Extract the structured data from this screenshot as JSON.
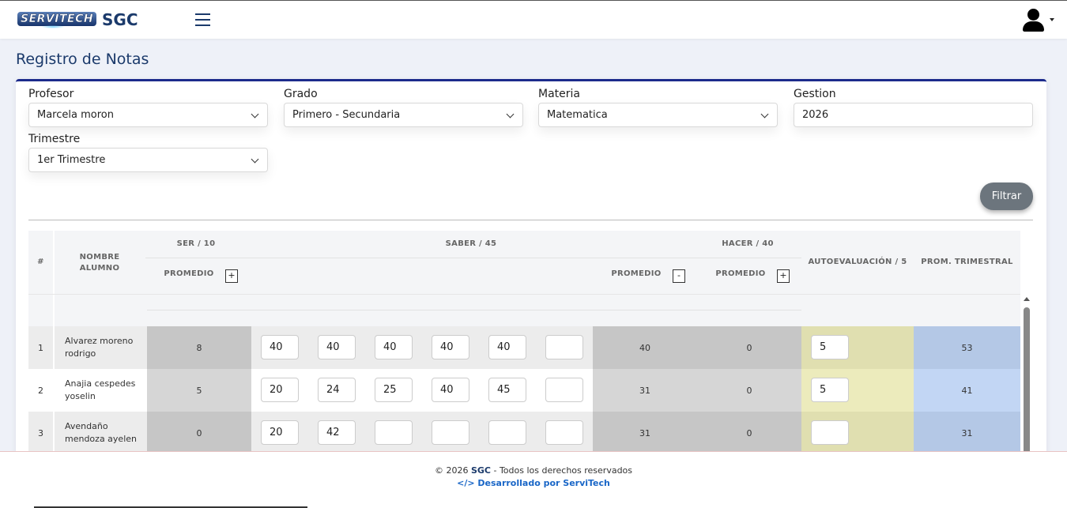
{
  "header": {
    "logo_text": "SERVITECH",
    "app_title": "SGC"
  },
  "page_title": "Registro de Notas",
  "filters": {
    "profesor": {
      "label": "Profesor",
      "value": "Marcela moron"
    },
    "grado": {
      "label": "Grado",
      "value": "Primero - Secundaria"
    },
    "materia": {
      "label": "Materia",
      "value": "Matematica"
    },
    "gestion": {
      "label": "Gestion",
      "value": "2026"
    },
    "trimestre": {
      "label": "Trimestre",
      "value": "1er Trimestre"
    },
    "filter_button": "Filtrar"
  },
  "table": {
    "headers": {
      "num": "#",
      "nombre": "NOMBRE ALUMNO",
      "ser": "SER / 10",
      "saber": "SABER / 45",
      "hacer": "HACER / 40",
      "autoevaluacion": "AUTOEVALUACIÓN / 5",
      "prom_trimestral": "PROM. TRIMESTRAL",
      "promedio": "PROMEDIO",
      "toggle_plus": "+",
      "toggle_minus": "-"
    },
    "rows": [
      {
        "num": "1",
        "name": "Alvarez moreno rodrigo",
        "ser": "8",
        "saber": [
          "40",
          "40",
          "40",
          "40",
          "40",
          ""
        ],
        "saber_prom": "40",
        "hacer_prom": "0",
        "auto": "5",
        "prom": "53"
      },
      {
        "num": "2",
        "name": "Anajia cespedes yoselin",
        "ser": "5",
        "saber": [
          "20",
          "24",
          "25",
          "40",
          "45",
          ""
        ],
        "saber_prom": "31",
        "hacer_prom": "0",
        "auto": "5",
        "prom": "41"
      },
      {
        "num": "3",
        "name": "Avendaño mendoza ayelen",
        "ser": "0",
        "saber": [
          "20",
          "42",
          "",
          "",
          "",
          ""
        ],
        "saber_prom": "31",
        "hacer_prom": "0",
        "auto": "",
        "prom": "31"
      }
    ]
  },
  "footer": {
    "copyright_prefix": "© 2026",
    "copyright_brand": "SGC",
    "copyright_suffix": "- Todos los derechos reservados",
    "dev_text": "</> Desarrollado por ServiTech"
  },
  "colors": {
    "brand": "#1b3a6b",
    "card_top_border": "#1c2b8c",
    "filter_button": "#6c757d",
    "ser_column": "#c8c8c8",
    "auto_column": "#e6e6b4",
    "prom_column": "#b4c8e6",
    "footer_link": "#1966c7"
  }
}
